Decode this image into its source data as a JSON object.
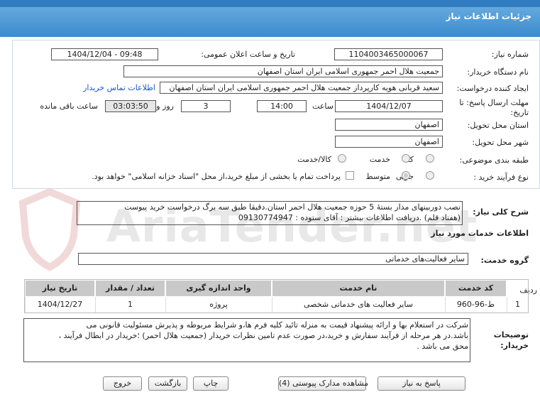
{
  "header": {
    "title": "جزئیات اطلاعات نیاز"
  },
  "form": {
    "need_number_label": "شماره نیاز:",
    "need_number": "1104003465000067",
    "announce_label": "تاریخ و ساعت اعلان عمومی:",
    "announce_value": "1404/12/04 - 09:48",
    "buyer_org_label": "نام دستگاه خریدار:",
    "buyer_org": "جمعیت هلال احمر جمهوری اسلامی ایران استان اصفهان",
    "creator_label": "ایجاد کننده درخواست:",
    "creator": "سعید قربانی هویه کارپرداز جمعیت هلال احمر جمهوری اسلامی ایران استان اصفهان",
    "contact_link": "اطلاعات تماس خریدار",
    "deadline_label_1": "مهلت ارسال پاسخ: تا",
    "deadline_label_2": "تاریخ:",
    "deadline_date": "1404/12/07",
    "time_label": "ساعت",
    "deadline_time": "14:00",
    "days_value": "3",
    "days_label": "روز و",
    "remaining_time": "03:03:50",
    "remaining_label": "ساعت باقی مانده",
    "province_label": "استان محل تحویل:",
    "province": "اصفهان",
    "city_label": "شهر محل تحویل:",
    "city": "اصفهان",
    "category_label": "طبقه بندی موضوعی:",
    "category_options": [
      "کالا",
      "خدمت",
      "کالا/خدمت"
    ],
    "purchase_label": "نوع فرآیند خرید :",
    "purchase_options": [
      "جزیی",
      "متوسط"
    ],
    "payment_text": "پرداخت تمام یا بخشی از مبلغ خرید،از محل \"اسناد خزانه اسلامی\" خواهد بود."
  },
  "description": {
    "label": "شرح کلی نیاز:",
    "text_line1": "نصب دوربینهای مدار بستهٔ 5 حوزه جمعیت هلال احمر استان.دقیقا طبق سه برگ درخواست خرید پیوست",
    "text_line2": "(هفتاد قلم) .دریافت اطلاعات بیشتر : آقای ستوده : 09130774947"
  },
  "services": {
    "section_title": "اطلاعات خدمات مورد نیاز",
    "group_label": "گروه خدمت:",
    "group_value": "سایر فعالیت‌های خدماتی"
  },
  "table": {
    "headers": [
      "ردیف",
      "کد خدمت",
      "نام خدمت",
      "واحد اندازه گیری",
      "تعداد / مقدار",
      "تاریخ نیاز"
    ],
    "rows": [
      [
        "1",
        "ط-96-960",
        "سایر فعالیت های خدماتی شخصی",
        "پروژه",
        "1",
        "1404/12/27"
      ]
    ]
  },
  "notes": {
    "label_1": "توضیحات",
    "label_2": "خریدار:",
    "line1": "شرکت در استعلام بها و ارائه پیشنهاد قیمت به منزله تائید کلیه فرم ها،و شرایط  مربوطه و پذیرش مسئولیت قانونی می",
    "line2": "باشد.در هر مرحله از فرآیند سفارش و خرید،در صورت عدم تامین نظرات خریدار (جمعیت هلال احمر) ؛خریدار در ابطال فرآیند ،",
    "line3": "محق می باشد ."
  },
  "buttons": {
    "reply": "پاسخ به نیاز",
    "docs": "مشاهده مدارک پیوستی (4)",
    "print": "چاپ",
    "back": "بازگشت",
    "exit": "خروج"
  },
  "watermark": {
    "text": "AriaTender.net"
  }
}
